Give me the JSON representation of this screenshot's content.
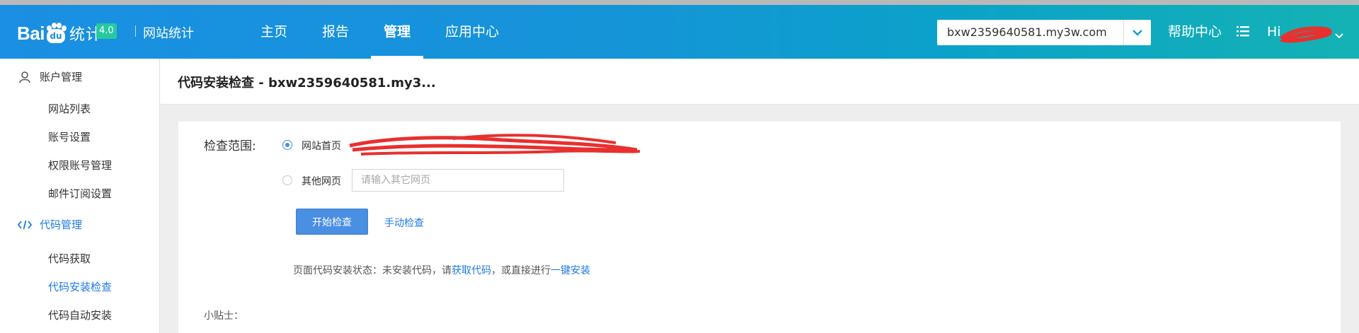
{
  "header": {
    "logo": {
      "brand_prefix": "Bai",
      "brand_paw_text": "du",
      "brand_suffix": "统计",
      "version_badge": "4.0",
      "product": "网站统计"
    },
    "nav": [
      {
        "label": "主页",
        "active": false
      },
      {
        "label": "报告",
        "active": false
      },
      {
        "label": "管理",
        "active": true
      },
      {
        "label": "应用中心",
        "active": false
      }
    ],
    "domain_select": {
      "value": "bxw2359640581.my3w.com"
    },
    "help": "帮助中心",
    "user_greeting": "Hi"
  },
  "sidebar": {
    "groups": [
      {
        "label": "账户管理",
        "icon": "user-icon",
        "items": [
          "网站列表",
          "账号设置",
          "权限账号管理",
          "邮件订阅设置"
        ]
      },
      {
        "label": "代码管理",
        "icon": "code-icon",
        "items": [
          "代码获取",
          "代码安装检查",
          "代码自动安装"
        ],
        "active_item": "代码安装检查"
      }
    ]
  },
  "main": {
    "title": "代码安装检查 - bxw2359640581.my3...",
    "check_range_label": "检查范围:",
    "options": {
      "homepage": {
        "label": "网站首页",
        "selected": true
      },
      "other": {
        "label": "其他网页",
        "selected": false,
        "placeholder": "请输入其它网页"
      }
    },
    "start_button": "开始检查",
    "manual_link": "手动检查",
    "status": {
      "prefix": "页面代码安装状态：未安装代码，请",
      "get_code_link": "获取代码",
      "middle": "，或直接进行",
      "install_link": "一键安装"
    },
    "tips_title": "小贴士："
  },
  "colors": {
    "header_start": "#1a8fe3",
    "header_end": "#14b2b4",
    "accent": "#1e7ae6",
    "button": "#4a8fe2",
    "redaction": "#e8302e"
  }
}
